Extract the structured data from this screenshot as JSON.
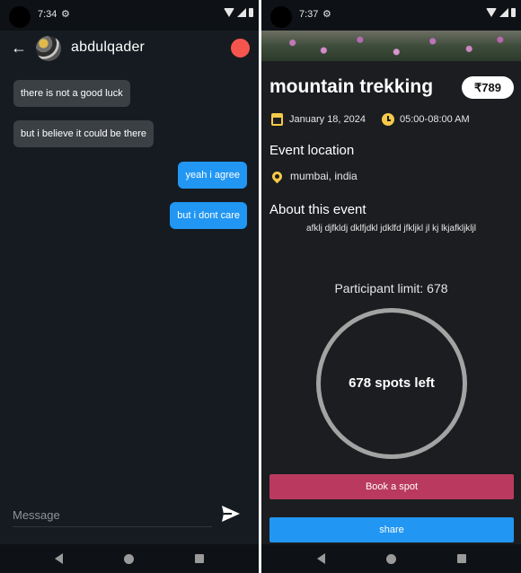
{
  "left": {
    "status": {
      "time": "7:34"
    },
    "header": {
      "name": "abdulqader"
    },
    "messages": [
      {
        "text": "there is not a good luck",
        "direction": "in"
      },
      {
        "text": "but i believe it could be there",
        "direction": "in"
      },
      {
        "text": "yeah i agree",
        "direction": "out"
      },
      {
        "text": "but i dont care",
        "direction": "out"
      }
    ],
    "input": {
      "placeholder": "Message"
    }
  },
  "right": {
    "status": {
      "time": "7:37"
    },
    "event": {
      "title": "mountain trekking",
      "price": "₹789",
      "date": "January 18, 2024",
      "time": "05:00-08:00 AM",
      "location_heading": "Event location",
      "location": "mumbai, india",
      "about_heading": "About this event",
      "description": "afklj djfkldj dklfjdkl jdklfd jfkljkl jl kj lkjafkljkljl",
      "participant_limit": "Participant limit: 678",
      "spots_left": "678 spots left",
      "book_label": "Book a spot",
      "share_label": "share"
    }
  },
  "colors": {
    "background": "#151b21",
    "incoming_bubble": "#3b4045",
    "outgoing_bubble": "#2196f3",
    "accent_yellow": "#f6c94a",
    "book_button": "#b93a5e",
    "share_button": "#2196f3",
    "status_dot": "#f6554e"
  },
  "icons": [
    "back-arrow-icon",
    "gear-icon",
    "wifi-icon",
    "signal-icon",
    "battery-icon",
    "send-icon",
    "calendar-icon",
    "clock-icon",
    "location-pin-icon",
    "nav-back-icon",
    "nav-home-icon",
    "nav-recent-icon"
  ]
}
